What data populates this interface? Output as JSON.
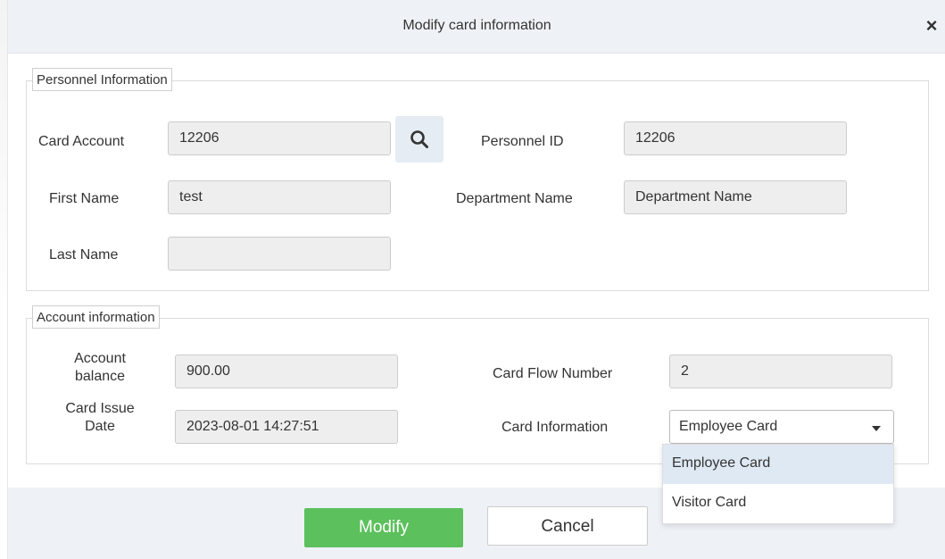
{
  "dialog": {
    "title": "Modify card information",
    "close_glyph": "×"
  },
  "personnel": {
    "legend": "Personnel Information",
    "card_account_label": "Card Account",
    "card_account_value": "12206",
    "personnel_id_label": "Personnel ID",
    "personnel_id_value": "12206",
    "first_name_label": "First Name",
    "first_name_value": "test",
    "department_label": "Department Name",
    "department_value": "Department Name",
    "last_name_label": "Last Name",
    "last_name_value": ""
  },
  "account": {
    "legend": "Account information",
    "balance_label_line1": "Account",
    "balance_label_line2": "balance",
    "balance_value": "900.00",
    "flow_label": "Card Flow Number",
    "flow_value": "2",
    "issue_label_line1": "Card Issue",
    "issue_label_line2": "Date",
    "issue_value": "2023-08-01 14:27:51",
    "card_info_label": "Card Information",
    "card_info_selected": "Employee Card",
    "card_info_options": [
      "Employee Card",
      "Visitor Card"
    ]
  },
  "footer": {
    "modify_label": "Modify",
    "cancel_label": "Cancel"
  },
  "icons": {
    "search": "search-icon",
    "close": "close-icon",
    "caret": "caret-down-icon"
  },
  "colors": {
    "primary": "#5cc05c",
    "header_bg": "#eef2f7",
    "field_bg": "#eeeeee",
    "selected_option_bg": "#dfe9f3"
  }
}
